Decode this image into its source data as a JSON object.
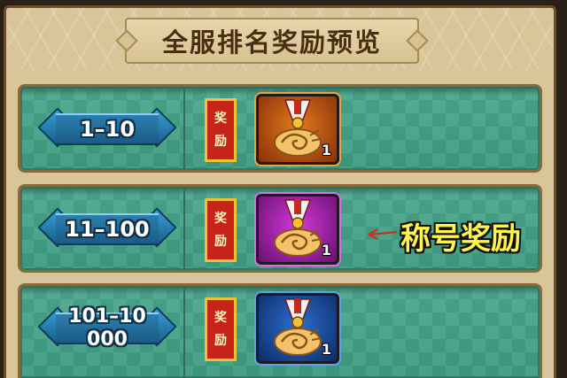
{
  "title": "全服排名奖励预览",
  "reward_label_chars": [
    "奖",
    "励"
  ],
  "rows": [
    {
      "rank_lines": [
        "1–10"
      ],
      "item_icon": "medal-scroll-icon",
      "rarity": "orange",
      "count": "1"
    },
    {
      "rank_lines": [
        "11–100"
      ],
      "item_icon": "medal-scroll-icon",
      "rarity": "purple",
      "count": "1"
    },
    {
      "rank_lines": [
        "101–10",
        "000"
      ],
      "item_icon": "medal-scroll-icon",
      "rarity": "blue",
      "count": "1"
    }
  ],
  "annotation": "称号奖励",
  "colors": {
    "rarity_orange": "#e07a1e",
    "rarity_purple": "#d23ad8",
    "rarity_blue": "#2d6fd0",
    "annotation": "#fff44a",
    "reward_tag": "#c62418"
  }
}
